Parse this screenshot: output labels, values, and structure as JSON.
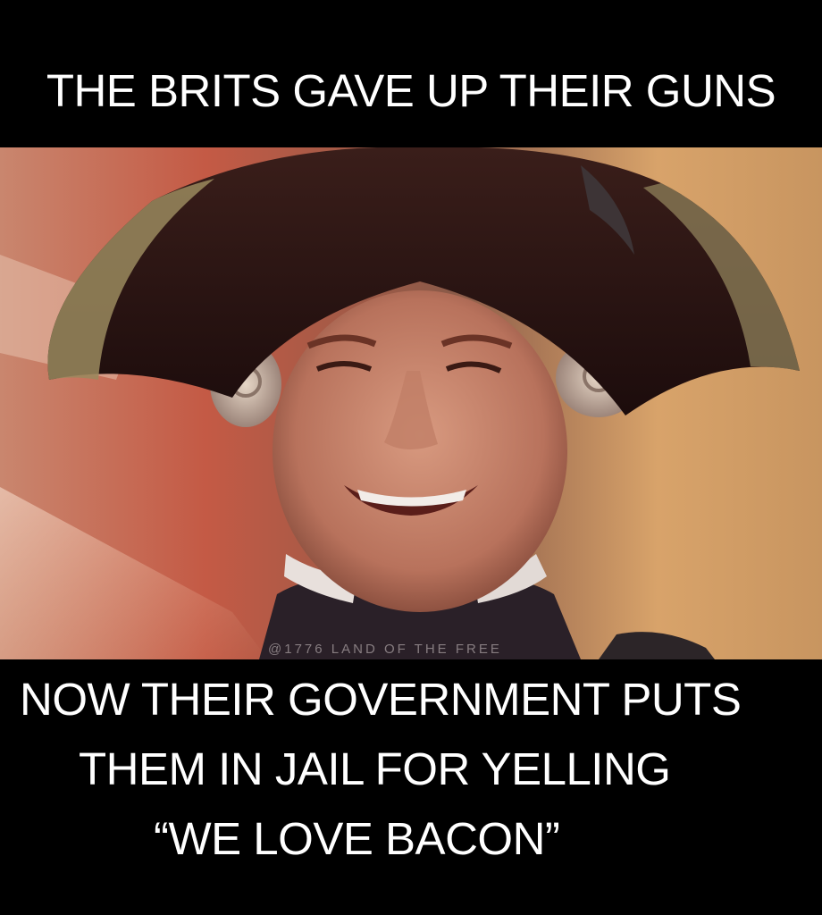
{
  "meme": {
    "top_caption": "THE BRITS GAVE UP THEIR GUNS",
    "bottom_caption": [
      "NOW THEIR GOVERNMENT PUTS",
      "THEM IN JAIL FOR YELLING",
      "“WE LOVE BACON”"
    ],
    "watermark": "@1776 LAND OF THE FREE"
  },
  "colors": {
    "banner": "#000000",
    "caption_text": "#ffffff"
  }
}
